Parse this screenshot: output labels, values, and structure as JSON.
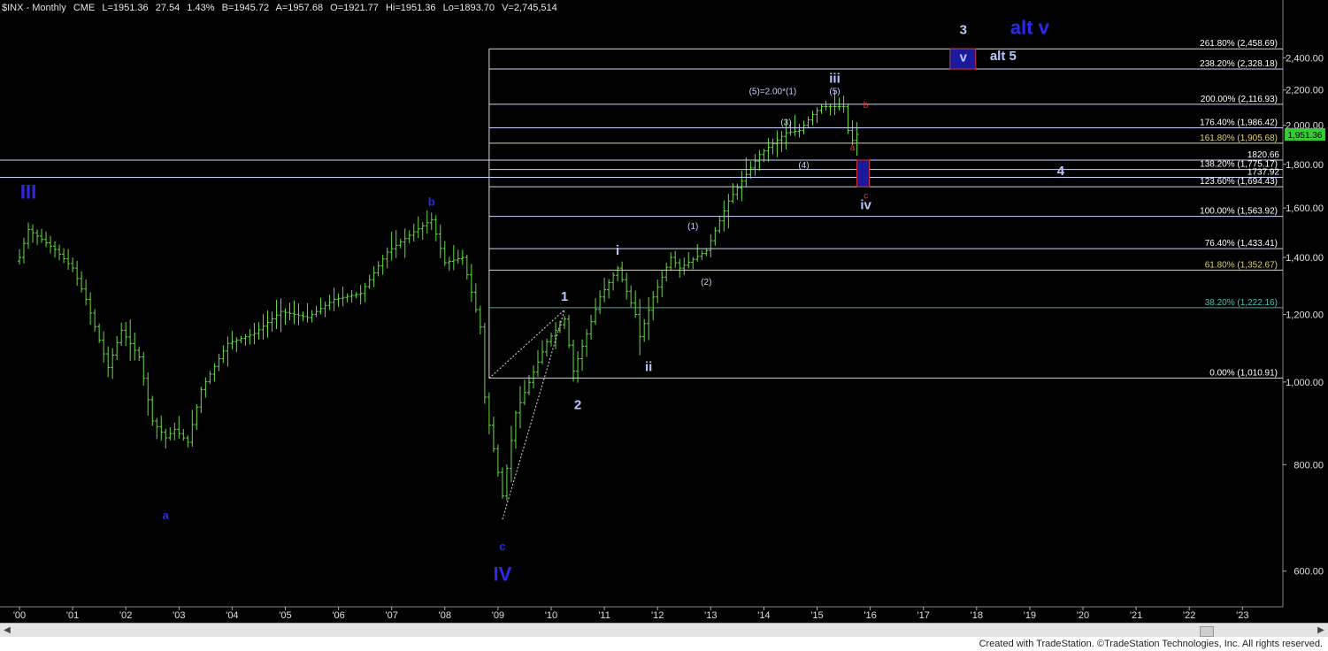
{
  "header": {
    "title": "$INX - Monthly",
    "exchange": "CME",
    "last": "L=1951.36",
    "change": "27.54",
    "change_pct": "1.43%",
    "bid": "B=1945.72",
    "ask": "A=1957.68",
    "open": "O=1921.77",
    "high": "Hi=1951.36",
    "low": "Lo=1893.70",
    "volume": "V=2,745,514"
  },
  "footer": {
    "credit": "Created with TradeStation. ©TradeStation Technologies, Inc. All rights reserved."
  },
  "colors": {
    "background": "#000000",
    "bars": "#66dd44",
    "fib_line": "#c8d4ff",
    "price_box": "#ccc",
    "wave_blue": "#2a2ae8",
    "wave_light": "#b8c8ff",
    "wave_red": "#ff3030"
  },
  "chart_data": {
    "type": "ohlc",
    "symbol": "$INX",
    "interval": "Monthly",
    "x_ticks": [
      "'00",
      "'01",
      "'02",
      "'03",
      "'04",
      "'05",
      "'06",
      "'07",
      "'08",
      "'09",
      "'10",
      "'11",
      "'12",
      "'13",
      "'14",
      "'15",
      "'16",
      "'17",
      "'18",
      "'19",
      "'20",
      "'21",
      "'22",
      "'23"
    ],
    "y_scale": "log",
    "y_ticks": [
      600,
      800,
      1000,
      1200,
      1400,
      1600,
      1800,
      2000,
      2200,
      2400
    ],
    "y_tick_labels": [
      "600.00",
      "800.00",
      "1,000.00",
      "1,200.00",
      "1,400.00",
      "1,600.00",
      "1,800.00",
      "2,000.00",
      "2,200.00",
      "2,400.00"
    ],
    "ylim": [
      545,
      2700
    ],
    "last_price": 1951.36,
    "last_price_label": "1,951.36",
    "monthly_close_anchors": [
      [
        "2000-01",
        1400
      ],
      [
        "2000-03",
        1510
      ],
      [
        "2000-09",
        1430
      ],
      [
        "2001-01",
        1360
      ],
      [
        "2001-04",
        1250
      ],
      [
        "2001-09",
        1040
      ],
      [
        "2001-12",
        1150
      ],
      [
        "2002-04",
        1070
      ],
      [
        "2002-07",
        900
      ],
      [
        "2002-10",
        860
      ],
      [
        "2002-12",
        880
      ],
      [
        "2003-03",
        850
      ],
      [
        "2003-06",
        980
      ],
      [
        "2003-12",
        1110
      ],
      [
        "2004-06",
        1140
      ],
      [
        "2004-12",
        1210
      ],
      [
        "2005-06",
        1190
      ],
      [
        "2005-12",
        1250
      ],
      [
        "2006-06",
        1270
      ],
      [
        "2006-12",
        1420
      ],
      [
        "2007-06",
        1500
      ],
      [
        "2007-10",
        1550
      ],
      [
        "2008-01",
        1380
      ],
      [
        "2008-05",
        1400
      ],
      [
        "2008-09",
        1160
      ],
      [
        "2008-10",
        960
      ],
      [
        "2008-11",
        890
      ],
      [
        "2009-02",
        735
      ],
      [
        "2009-05",
        920
      ],
      [
        "2009-12",
        1115
      ],
      [
        "2010-04",
        1185
      ],
      [
        "2010-06",
        1030
      ],
      [
        "2010-12",
        1258
      ],
      [
        "2011-04",
        1360
      ],
      [
        "2011-08",
        1200
      ],
      [
        "2011-09",
        1130
      ],
      [
        "2011-12",
        1258
      ],
      [
        "2012-04",
        1400
      ],
      [
        "2012-06",
        1360
      ],
      [
        "2012-12",
        1426
      ],
      [
        "2013-05",
        1630
      ],
      [
        "2013-12",
        1848
      ],
      [
        "2014-06",
        1960
      ],
      [
        "2014-09",
        1972
      ],
      [
        "2014-12",
        2059
      ],
      [
        "2015-02",
        2104
      ],
      [
        "2015-07",
        2104
      ],
      [
        "2015-08",
        1972
      ],
      [
        "2015-09",
        1920
      ],
      [
        "2015-10",
        1951
      ]
    ],
    "fib_levels": [
      {
        "label": "261.80% (2,458.69)",
        "value": 2458.69
      },
      {
        "label": "238.20% (2,328.18)",
        "value": 2328.18
      },
      {
        "label": "200.00% (2,116.93)",
        "value": 2116.93
      },
      {
        "label": "176.40% (1,986.42)",
        "value": 1986.42
      },
      {
        "label": "161.80% (1,905.68)",
        "value": 1905.68
      },
      {
        "label": "138.20% (1,775.17)",
        "value": 1775.17
      },
      {
        "label": "123.60% (1,694.43)",
        "value": 1694.43
      },
      {
        "label": "100.00% (1,563.92)",
        "value": 1563.92
      },
      {
        "label": "76.40% (1,433.41)",
        "value": 1433.41
      },
      {
        "label": "61.80% (1,352.67)",
        "value": 1352.67
      },
      {
        "label": "38.20% (1,222.16)",
        "value": 1222.16
      },
      {
        "label": "0.00% (1,010.91)",
        "value": 1010.91
      }
    ],
    "horizontal_lines": [
      {
        "label": "1820.66",
        "value": 1820.66
      },
      {
        "label": "1737.92",
        "value": 1737.92
      }
    ],
    "target_boxes": [
      {
        "from": "2015-10",
        "to": "2015-12",
        "low": 1694.43,
        "high": 1820.66
      },
      {
        "from": "2017-07",
        "to": "2017-12",
        "low": 2328.18,
        "high": 2458.69
      }
    ],
    "wave_labels": [
      {
        "text": "III",
        "date": "2000-03",
        "value": 1640,
        "style": "big-blue"
      },
      {
        "text": "a",
        "date": "2002-10",
        "value": 690,
        "style": "small-blue"
      },
      {
        "text": "b",
        "date": "2007-10",
        "value": 1610,
        "style": "small-blue"
      },
      {
        "text": "c",
        "date": "2009-02",
        "value": 635,
        "style": "small-blue"
      },
      {
        "text": "IV",
        "date": "2009-02",
        "value": 585,
        "style": "big-blue"
      },
      {
        "text": "1",
        "date": "2010-04",
        "value": 1245,
        "style": "light"
      },
      {
        "text": "2",
        "date": "2010-07",
        "value": 930,
        "style": "light"
      },
      {
        "text": "i",
        "date": "2011-04",
        "value": 1410,
        "style": "light"
      },
      {
        "text": "ii",
        "date": "2011-11",
        "value": 1030,
        "style": "light"
      },
      {
        "text": "(1)",
        "date": "2012-09",
        "value": 1512,
        "style": "paren"
      },
      {
        "text": "(2)",
        "date": "2012-12",
        "value": 1300,
        "style": "paren"
      },
      {
        "text": "(3)",
        "date": "2014-06",
        "value": 2000,
        "style": "paren"
      },
      {
        "text": "(4)",
        "date": "2014-10",
        "value": 1782,
        "style": "paren"
      },
      {
        "text": "(5)=2.00*(1)",
        "date": "2014-03",
        "value": 2175,
        "style": "paren"
      },
      {
        "text": "(5)",
        "date": "2015-05",
        "value": 2175,
        "style": "paren"
      },
      {
        "text": "iii",
        "date": "2015-05",
        "value": 2245,
        "style": "light"
      },
      {
        "text": "a",
        "date": "2015-09",
        "value": 1870,
        "style": "red"
      },
      {
        "text": "b",
        "date": "2015-12",
        "value": 2095,
        "style": "red"
      },
      {
        "text": "c",
        "date": "2015-12",
        "value": 1640,
        "style": "red"
      },
      {
        "text": "iv",
        "date": "2015-12",
        "value": 1595,
        "style": "light"
      },
      {
        "text": "4",
        "date": "2019-08",
        "value": 1748,
        "style": "light"
      },
      {
        "text": "3",
        "date": "2017-10",
        "value": 2560,
        "style": "light"
      },
      {
        "text": "v",
        "date": "2017-10",
        "value": 2375,
        "style": "light"
      },
      {
        "text": "alt v",
        "date": "2019-01",
        "value": 2560,
        "style": "big-blue"
      },
      {
        "text": "alt 5",
        "date": "2018-07",
        "value": 2385,
        "style": "light"
      }
    ],
    "dotted_wave_lines": [
      [
        [
          "2008-11",
          1010
        ],
        [
          "2010-04",
          1215
        ]
      ],
      [
        [
          "2009-02",
          690
        ],
        [
          "2010-04",
          1215
        ]
      ]
    ]
  }
}
